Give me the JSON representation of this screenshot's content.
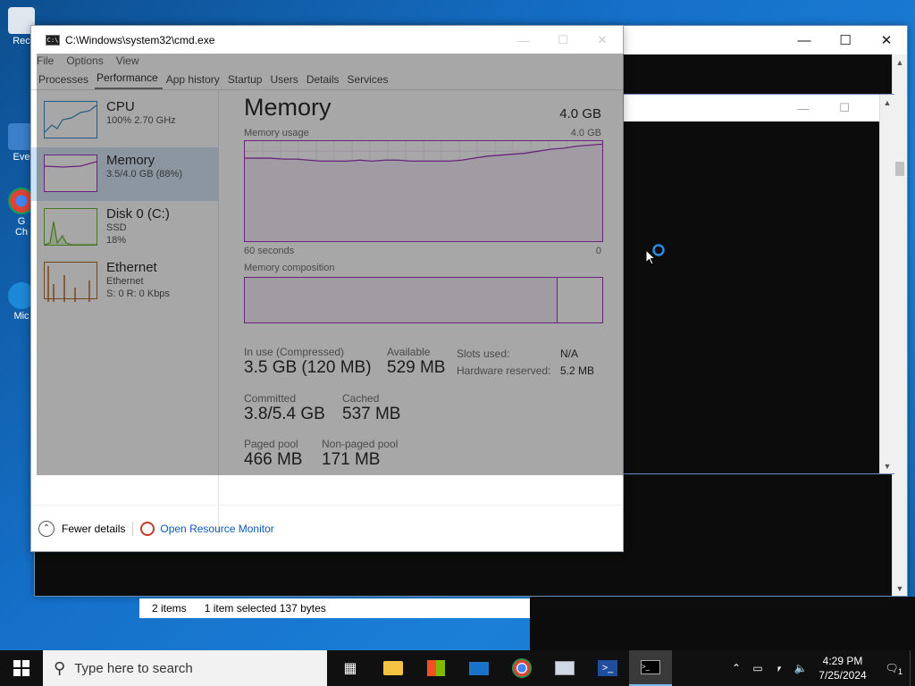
{
  "desktop": {
    "icons": [
      {
        "label": "Rec"
      },
      {
        "label": "Eve"
      },
      {
        "label": "G\nCh"
      },
      {
        "label": "Mic"
      }
    ]
  },
  "cmd_window": {
    "title": "C:\\Windows\\system32\\cmd.exe"
  },
  "task_manager": {
    "menu": [
      "File",
      "Options",
      "View"
    ],
    "tabs": [
      "Processes",
      "Performance",
      "App history",
      "Startup",
      "Users",
      "Details",
      "Services"
    ],
    "active_tab": "Performance",
    "sidebar": [
      {
        "name": "CPU",
        "line1": "100%  2.70 GHz",
        "line2": ""
      },
      {
        "name": "Memory",
        "line1": "3.5/4.0 GB (88%)",
        "line2": ""
      },
      {
        "name": "Disk 0 (C:)",
        "line1": "SSD",
        "line2": "18%"
      },
      {
        "name": "Ethernet",
        "line1": "Ethernet",
        "line2": "S: 0  R: 0 Kbps"
      }
    ],
    "memory": {
      "title": "Memory",
      "total": "4.0 GB",
      "usage_label": "Memory usage",
      "usage_max": "4.0 GB",
      "time_left": "60 seconds",
      "time_right": "0",
      "composition_label": "Memory composition",
      "stats": {
        "in_use_label": "In use (Compressed)",
        "in_use_value": "3.5 GB (120 MB)",
        "available_label": "Available",
        "available_value": "529 MB",
        "slots_label": "Slots used:",
        "slots_value": "N/A",
        "hw_reserved_label": "Hardware reserved:",
        "hw_reserved_value": "5.2 MB",
        "committed_label": "Committed",
        "committed_value": "3.8/5.4 GB",
        "cached_label": "Cached",
        "cached_value": "537 MB",
        "paged_label": "Paged pool",
        "paged_value": "466 MB",
        "nonpaged_label": "Non-paged pool",
        "nonpaged_value": "171 MB"
      },
      "usage_history_fraction": [
        0.83,
        0.83,
        0.83,
        0.82,
        0.82,
        0.81,
        0.8,
        0.8,
        0.8,
        0.81,
        0.8,
        0.81,
        0.81,
        0.8,
        0.8,
        0.8,
        0.8,
        0.81,
        0.83,
        0.85,
        0.86,
        0.87,
        0.88,
        0.9,
        0.92,
        0.93,
        0.95,
        0.96,
        0.97
      ]
    },
    "footer": {
      "fewer_details": "Fewer details",
      "open_resource_monitor": "Open Resource Monitor"
    }
  },
  "explorer_status": {
    "items": "2 items",
    "selected": "1 item selected  137 bytes"
  },
  "taskbar": {
    "search_placeholder": "Type here to search",
    "time": "4:29 PM",
    "date": "7/25/2024",
    "notification_count": "1"
  },
  "colors": {
    "memory_accent": "#8b12ae",
    "cpu_accent": "#1177bb",
    "disk_accent": "#4da60c",
    "ethernet_accent": "#a74f01",
    "link": "#0b5ab8"
  }
}
